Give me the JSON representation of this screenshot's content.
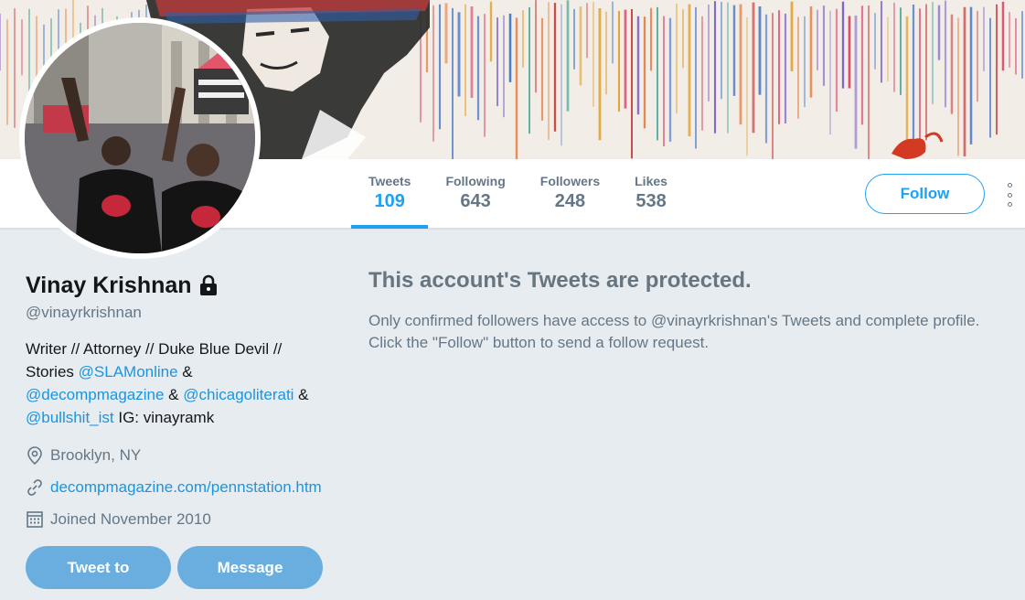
{
  "profile": {
    "name": "Vinay Krishnan",
    "handle": "@vinayrkrishnan",
    "bio": {
      "line1": "Writer // Attorney // Duke Blue Devil //",
      "stories": "Stories ",
      "mention1": "@SLAMonline",
      "amp1": " &",
      "mention2": "@decompmagazine",
      "amp2": " & ",
      "mention3": "@chicagoliterati",
      "amp3": " &",
      "mention4": "@bullshit_ist",
      "ig": " IG: vinayramk"
    },
    "location": "Brooklyn, NY",
    "website": "decompmagazine.com/pennstation.htm",
    "joined": "Joined November 2010",
    "tweet_to_label": "Tweet to",
    "message_label": "Message"
  },
  "nav": {
    "stats": [
      {
        "label": "Tweets",
        "value": "109",
        "active": true
      },
      {
        "label": "Following",
        "value": "643",
        "active": false
      },
      {
        "label": "Followers",
        "value": "248",
        "active": false
      },
      {
        "label": "Likes",
        "value": "538",
        "active": false
      }
    ],
    "follow_label": "Follow"
  },
  "protected": {
    "title": "This account's Tweets are protected.",
    "line1": "Only confirmed followers have access to @vinayrkrishnan's Tweets and complete profile.",
    "line2": "Click the \"Follow\" button to send a follow request."
  },
  "colors": {
    "accent": "#1da1f2",
    "link": "#1b95e0",
    "muted": "#657786",
    "background": "#e6ecf0",
    "button_disabled": "#6aaee0"
  },
  "icons": [
    "lock-icon",
    "location-pin-icon",
    "link-icon",
    "calendar-icon",
    "more-dots-icon"
  ]
}
